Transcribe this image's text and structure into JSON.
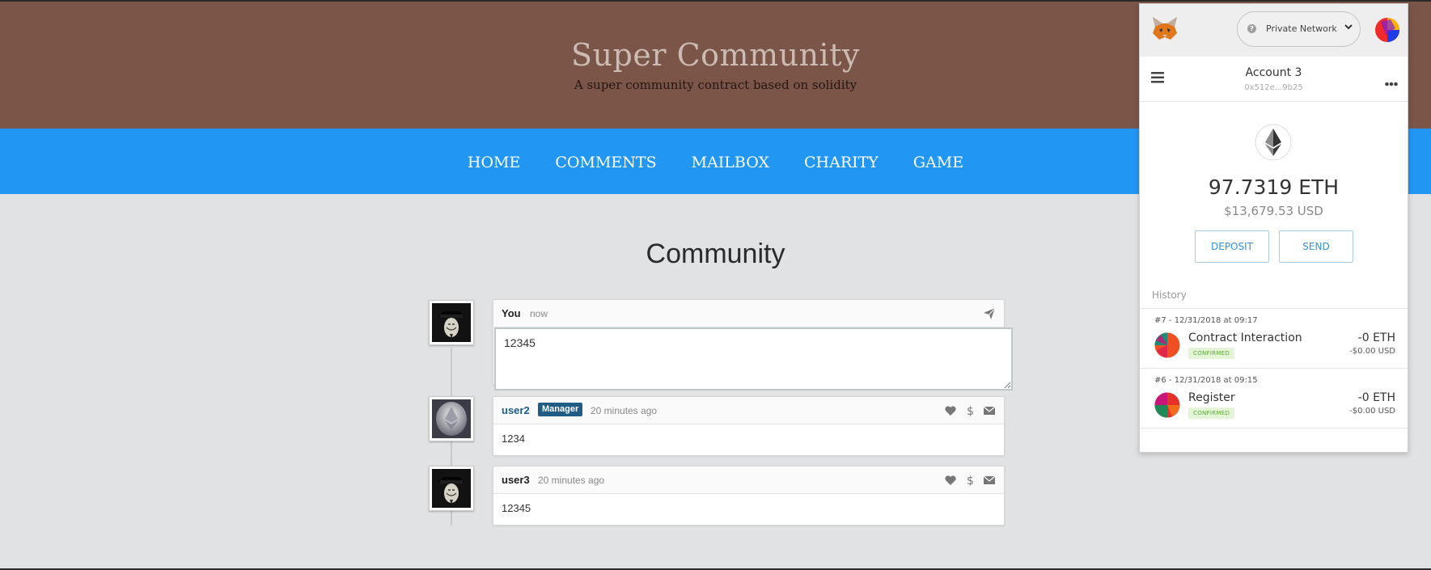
{
  "site": {
    "title": "Super Community",
    "subtitle": "A super community contract based on solidity",
    "nav": [
      "HOME",
      "COMMENTS",
      "MAILBOX",
      "CHARITY",
      "GAME"
    ]
  },
  "main": {
    "title": "Community",
    "composer": {
      "user": "You",
      "time": "now",
      "value": "12345"
    },
    "comments": [
      {
        "user": "user2",
        "badge": "Manager",
        "time": "20 minutes ago",
        "text": "1234"
      },
      {
        "user": "user3",
        "time": "20 minutes ago",
        "text": "12345"
      }
    ]
  },
  "metamask": {
    "network": "Private Network",
    "account_name": "Account 3",
    "account_address": "0x512e...9b25",
    "balance": "97.7319 ETH",
    "fiat": "$13,679.53 USD",
    "deposit_label": "DEPOSIT",
    "send_label": "SEND",
    "history_title": "History",
    "transactions": [
      {
        "meta": "#7 - 12/31/2018 at 09:17",
        "name": "Contract Interaction",
        "status": "CONFIRMED",
        "amount": "-0 ETH",
        "usd": "-$0.00 USD"
      },
      {
        "meta": "#6 - 12/31/2018 at 09:15",
        "name": "Register",
        "status": "CONFIRMED",
        "amount": "-0 ETH",
        "usd": "-$0.00 USD"
      }
    ]
  },
  "colors": {
    "header_bg": "#7b5548",
    "nav_bg": "#2196f3",
    "page_bg": "#e1e2e4",
    "accent_link": "#1a5f8a"
  }
}
